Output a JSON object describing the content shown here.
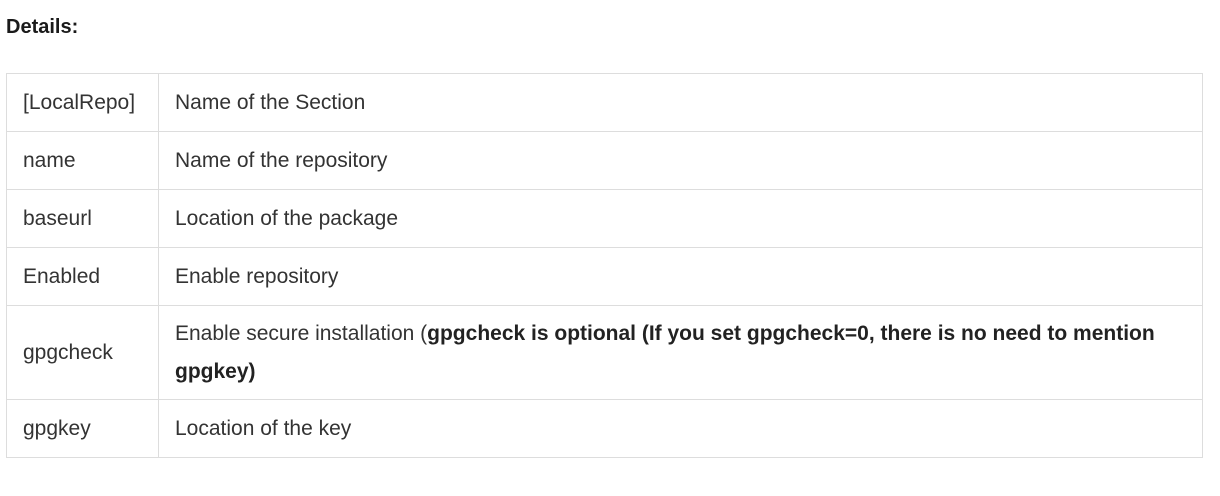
{
  "heading": "Details:",
  "rows": [
    {
      "key": "[LocalRepo]",
      "value": "Name of the Section"
    },
    {
      "key": "name",
      "value": "Name of the repository"
    },
    {
      "key": "baseurl",
      "value": "Location of the package"
    },
    {
      "key": "Enabled",
      "value": "Enable repository"
    },
    {
      "key": "gpgcheck",
      "value": "Enable secure installation (",
      "value_bold": "gpgcheck is optional (If you set gpgcheck=0, there is no need to mention gpgkey)"
    },
    {
      "key": "gpgkey",
      "value": "Location of the key"
    }
  ]
}
